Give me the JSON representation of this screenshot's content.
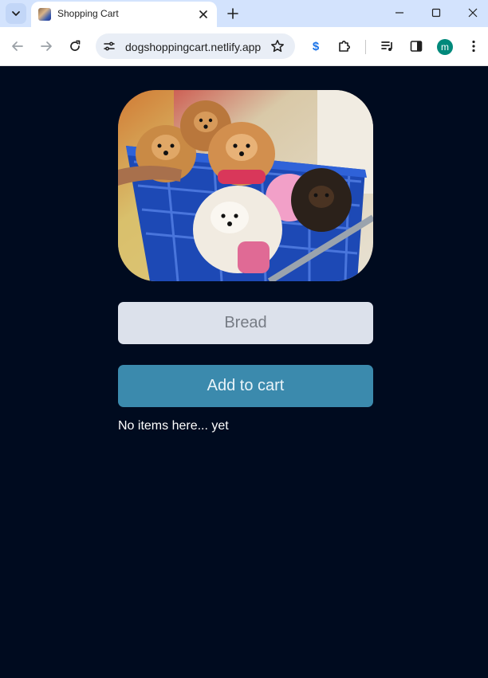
{
  "browser": {
    "tab_title": "Shopping Cart",
    "url": "dogshoppingcart.netlify.app",
    "profile_initial": "m",
    "extension_symbol": "$",
    "colors": {
      "tabstrip": "#d3e3fd",
      "profile": "#00897b",
      "extension": "#1a73e8"
    }
  },
  "page": {
    "hero_image": "pomeranian-dogs-in-shopping-cart",
    "input": {
      "placeholder": "Bread",
      "value": ""
    },
    "add_button_label": "Add to cart",
    "empty_message": "No items here... yet",
    "colors": {
      "background": "#000b1f",
      "input_bg": "#dce1eb",
      "button_bg": "#3b8aad",
      "text": "#ffffff"
    }
  }
}
